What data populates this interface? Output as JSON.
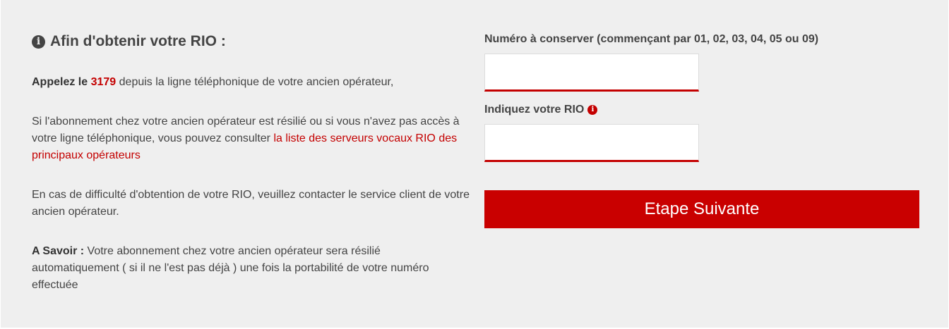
{
  "info": {
    "heading": "Afin d'obtenir votre RIO :",
    "icon": "info-circle-icon",
    "p1": {
      "bold_prefix": "Appelez le",
      "number": "3179",
      "rest": "depuis la ligne téléphonique de votre ancien opérateur,"
    },
    "p2": {
      "text": "Si l'abonnement chez votre ancien opérateur est résilié ou si vous n'avez pas accès à votre ligne téléphonique, vous pouvez consulter",
      "link": "la liste des serveurs vocaux RIO des principaux opérateurs"
    },
    "p3": {
      "text": "En cas de difficulté d'obtention de votre RIO, veuillez contacter le service client de votre ancien opérateur."
    },
    "p4": {
      "bold_prefix": "A Savoir :",
      "text": "Votre abonnement chez votre ancien opérateur sera résilié automatiquement ( si il ne l'est pas déjà ) une fois la portabilité de votre numéro effectuée"
    }
  },
  "form": {
    "number_label": "Numéro à conserver (commençant par 01, 02, 03, 04, 05 ou 09)",
    "number_value": "",
    "rio_label": "Indiquez votre RIO",
    "rio_value": "",
    "rio_help_icon": "info-circle-icon",
    "next_button": "Etape Suivante"
  },
  "colors": {
    "accent": "#c90000",
    "panel_bg": "#efefef",
    "text": "#444444"
  }
}
